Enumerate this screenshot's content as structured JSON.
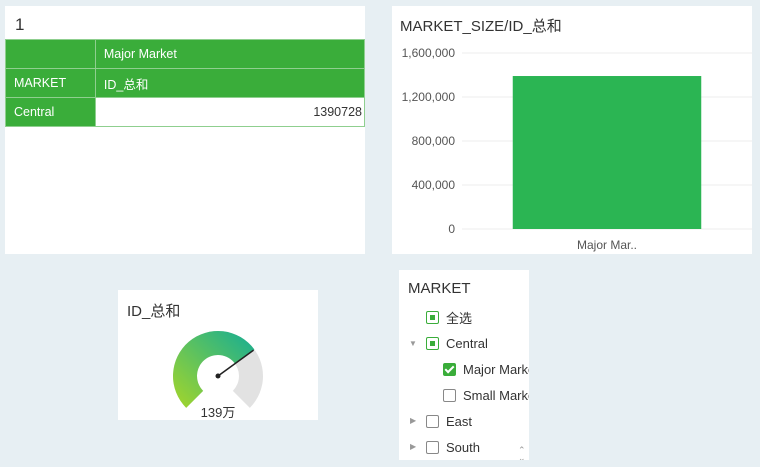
{
  "pivot": {
    "title": "1",
    "header_row1": [
      "",
      "Major Market"
    ],
    "header_row2": [
      "MARKET",
      "ID_总和"
    ],
    "rows": [
      {
        "label": "Central",
        "value": "1390728"
      }
    ]
  },
  "chart_data": {
    "type": "bar",
    "title": "MARKET_SIZE/ID_总和",
    "categories": [
      "Major Mar.."
    ],
    "values": [
      1390728
    ],
    "yticks": [
      "0",
      "400,000",
      "800,000",
      "1,200,000",
      "1,600,000"
    ],
    "ylim": [
      0,
      1600000
    ],
    "color": "#2bb553",
    "grid": true
  },
  "gauge": {
    "title": "ID_总和",
    "value_label": "139万",
    "fraction": 0.7
  },
  "filter": {
    "title": "MARKET",
    "select_all": "全选",
    "items": [
      {
        "label": "Central",
        "state": "partial",
        "expanded": true,
        "children": [
          {
            "label": "Major Market",
            "state": "checked"
          },
          {
            "label": "Small Market",
            "state": "unchecked"
          }
        ]
      },
      {
        "label": "East",
        "state": "unchecked",
        "expanded": false
      },
      {
        "label": "South",
        "state": "unchecked",
        "expanded": false
      }
    ],
    "colors": {
      "accent": "#3aad3a"
    }
  }
}
